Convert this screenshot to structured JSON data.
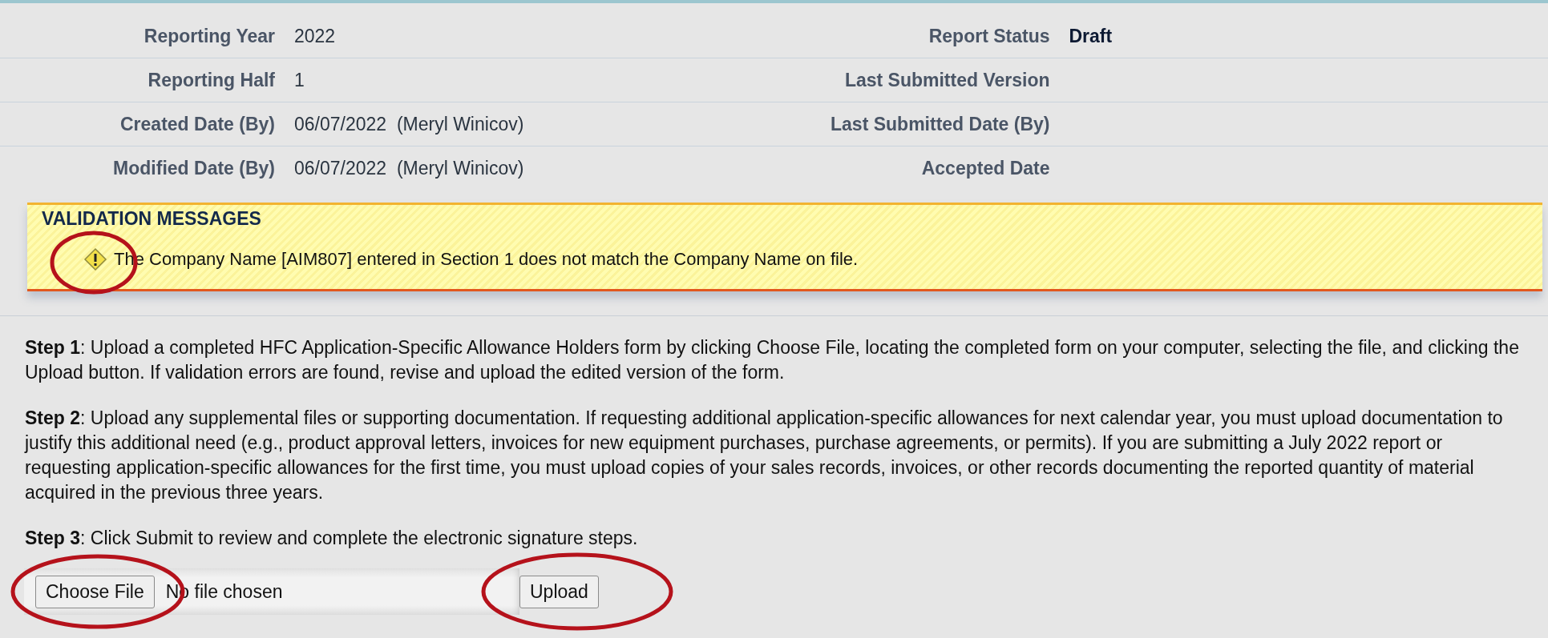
{
  "summary": {
    "left": [
      {
        "label": "Reporting Year",
        "value": "2022"
      },
      {
        "label": "Reporting Half",
        "value": "1"
      },
      {
        "label": "Created Date (By)",
        "value": "06/07/2022  (Meryl Winicov)"
      },
      {
        "label": "Modified Date (By)",
        "value": "06/07/2022  (Meryl Winicov)"
      }
    ],
    "right": [
      {
        "label": "Report Status",
        "value": "Draft"
      },
      {
        "label": "Last Submitted Version"
      },
      {
        "label": "Last Submitted Date (By)"
      },
      {
        "label": "Accepted Date"
      }
    ]
  },
  "validation": {
    "title": "VALIDATION MESSAGES",
    "messages": [
      {
        "kind": "warning",
        "text": "The Company Name [AIM807] entered in Section 1 does not match the Company Name on file."
      }
    ]
  },
  "steps": [
    {
      "text": "**Step 1**: Upload a completed HFC Application-Specific Allowance Holders form by clicking Choose File, locating the completed form on your computer, selecting the file, and clicking the Upload button. If validation errors are found, revise and upload the edited version of the form."
    },
    {
      "text": "**Step 2**: Upload any supplemental files or supporting documentation. If requesting additional application-specific allowances for next calendar year, you must upload documentation to justify this additional need (e.g., product approval letters, invoices for new equipment purchases, purchase agreements, or permits). If you are submitting a July 2022 report or requesting application-specific allowances for the first time, you must upload copies of your sales records, invoices, or other records documenting the reported quantity of material acquired in the previous three years."
    },
    {
      "text": "**Step 3**: Click Submit to review and complete the electronic signature steps."
    }
  ],
  "upload": {
    "choose_button": "Choose File",
    "file_status": "No file chosen",
    "upload_button": "Upload"
  }
}
